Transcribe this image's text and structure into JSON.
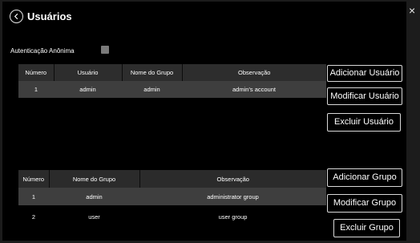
{
  "dialog": {
    "title": "Usuários",
    "close_glyph": "×"
  },
  "anonymous_auth": {
    "label": "Autenticação Anônima",
    "checked": false
  },
  "users": {
    "columns": [
      "Número",
      "Usuário",
      "Nome do Grupo",
      "Observação"
    ],
    "rows": [
      {
        "numero": "1",
        "usuario": "admin",
        "grupo": "admin",
        "observacao": "admin's account"
      }
    ],
    "buttons": {
      "add": "Adicionar Usuário",
      "modify": "Modificar Usuário",
      "delete": "Excluir Usuário"
    }
  },
  "groups": {
    "columns": [
      "Número",
      "Nome do Grupo",
      "Observação"
    ],
    "rows": [
      {
        "numero": "1",
        "grupo": "admin",
        "observacao": "administrator group"
      },
      {
        "numero": "2",
        "grupo": "user",
        "observacao": "user group"
      }
    ],
    "buttons": {
      "add": "Adicionar Grupo",
      "modify": "Modificar Grupo",
      "delete": "Excluir Grupo"
    }
  },
  "icons": {
    "back": "chevron-left-circle-icon",
    "close": "close-icon"
  },
  "colors": {
    "background": "#000000",
    "header_row": "#2d2d2d",
    "selected_row": "#3e3e3e",
    "checkbox": "#7a7a7a",
    "button_border": "#d8d8d8"
  }
}
